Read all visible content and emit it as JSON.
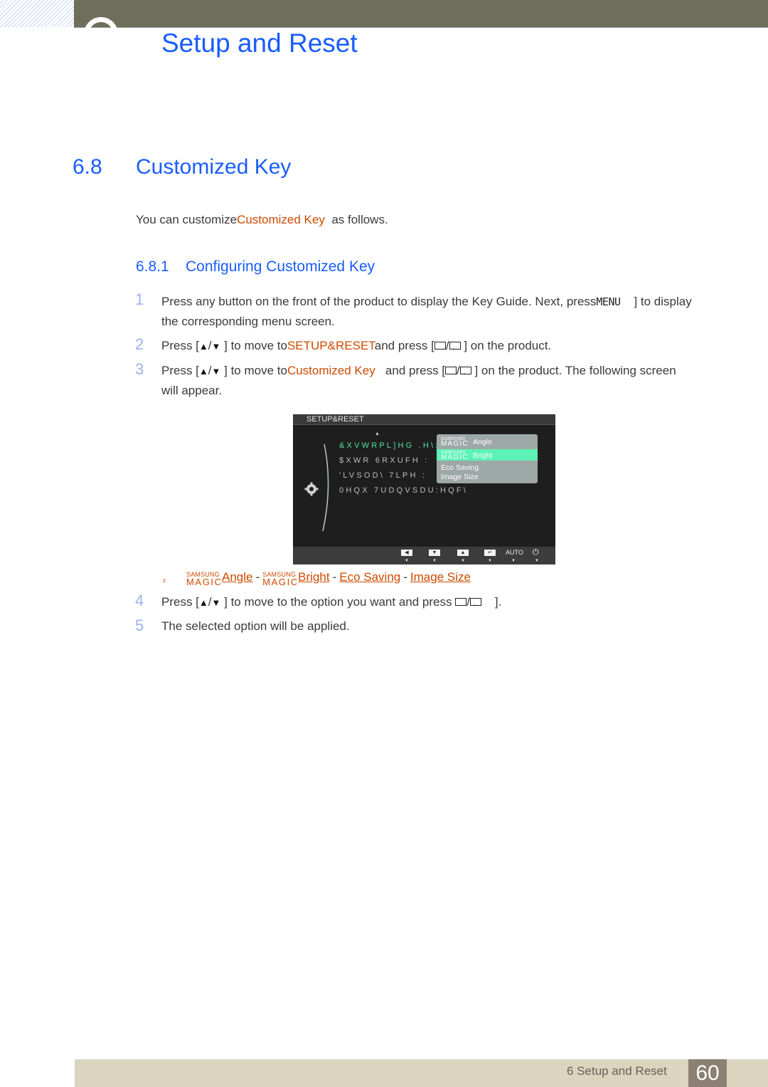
{
  "header": {
    "chapter_title": "Setup and Reset",
    "brand_color": "#1a5cff",
    "bar_color": "#6e6e5b"
  },
  "section": {
    "number": "6.8",
    "title": "Customized Key",
    "intro_prefix": "You can customize",
    "intro_highlight": "Customized Key",
    "intro_suffix": "as follows."
  },
  "subsection": {
    "number": "6.8.1",
    "title": "Configuring Customized Key"
  },
  "steps": [
    {
      "num": "1",
      "line1_a": "Press any button on the front of the product to display the Key Guide. Next, press",
      "menu_key": "MENU",
      "line1_b": "] to display",
      "line2": "the corresponding menu screen."
    },
    {
      "num": "2",
      "a": "Press [",
      "b": "] to move to",
      "highlight": "SETUP&RESET",
      "c": "and press [",
      "d": "] on the product."
    },
    {
      "num": "3",
      "a": "Press [",
      "b": "] to move to",
      "highlight": "Customized Key",
      "c": "and press [",
      "d": "] on the product. The following screen",
      "line2": "will appear."
    },
    {
      "num": "4",
      "a": "Press [",
      "b": "] to move to the option you want and press",
      "d": "]."
    },
    {
      "num": "5",
      "a": "The selected option will be applied."
    }
  ],
  "arrows": {
    "up": "▲",
    "slash": "/",
    "down": "▼"
  },
  "osd": {
    "title": "SETUP&RESET",
    "menu_items": [
      {
        "label": "&XVWRPL]HG .H\\:",
        "active": true
      },
      {
        "label": "$XWR 6RXUFH    :",
        "active": false
      },
      {
        "label": "'LVSOD\\ 7LPH    :",
        "active": false
      },
      {
        "label": "0HQX 7UDQVSDU:HQF\\",
        "active": false
      }
    ],
    "popup_items": [
      {
        "brand_top": "SAMSUNG",
        "brand_bottom": "MAGIC",
        "label": "Angle",
        "selected": false
      },
      {
        "brand_top": "SAMSUNG",
        "brand_bottom": "MAGIC",
        "label": "Bright",
        "selected": true
      },
      {
        "label": "Eco Saving",
        "selected": false
      },
      {
        "label": "Image Size",
        "selected": false
      }
    ],
    "footer_buttons": [
      "◀",
      "▼",
      "▲",
      "↵"
    ],
    "auto_label": "AUTO",
    "power_icon": "⏻",
    "marker": "▼"
  },
  "options": {
    "bullet": "z",
    "items": [
      {
        "brand_top": "SAMSUNG",
        "brand_bottom": "MAGIC",
        "label": "Angle"
      },
      {
        "brand_top": "SAMSUNG",
        "brand_bottom": "MAGIC",
        "label": "Bright"
      },
      {
        "label": "Eco Saving"
      },
      {
        "label": "Image Size"
      }
    ],
    "separator": "-"
  },
  "footer": {
    "text": "6 Setup and Reset",
    "page": "60"
  }
}
